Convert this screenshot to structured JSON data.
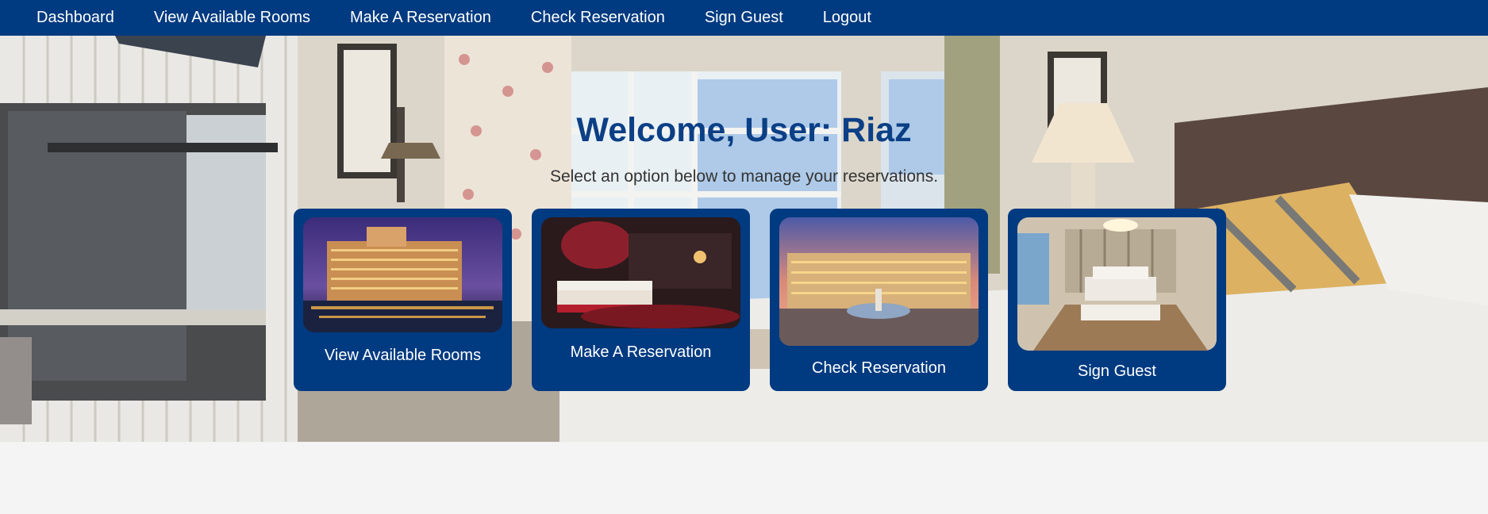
{
  "nav": {
    "items": [
      {
        "label": "Dashboard"
      },
      {
        "label": "View Available Rooms"
      },
      {
        "label": "Make A Reservation"
      },
      {
        "label": "Check Reservation"
      },
      {
        "label": "Sign Guest"
      },
      {
        "label": "Logout"
      }
    ]
  },
  "hero": {
    "welcome": "Welcome, User: Riaz",
    "subtitle": "Select an option below to manage your reservations."
  },
  "cards": [
    {
      "label": "View Available Rooms",
      "image": "hotel-exterior-night"
    },
    {
      "label": "Make A Reservation",
      "image": "red-bedroom"
    },
    {
      "label": "Check Reservation",
      "image": "plaza-fountain-dusk"
    },
    {
      "label": "Sign Guest",
      "image": "luxury-bedroom"
    }
  ],
  "colors": {
    "navbar": "#003a80",
    "card": "#003a80",
    "welcome_text": "#0b3f86",
    "page_bg": "#f4f4f4"
  }
}
